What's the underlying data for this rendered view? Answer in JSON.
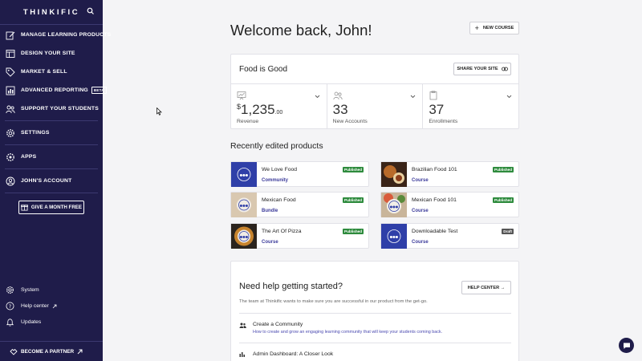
{
  "brand": {
    "logo": "THINKIFIC"
  },
  "sidebar": {
    "items": [
      {
        "label": "MANAGE LEARNING PRODUCTS",
        "icon": "edit-icon"
      },
      {
        "label": "DESIGN YOUR SITE",
        "icon": "layout-icon"
      },
      {
        "label": "MARKET & SELL",
        "icon": "tag-icon"
      },
      {
        "label": "ADVANCED REPORTING",
        "icon": "chart-icon",
        "badge": "BETA"
      },
      {
        "label": "SUPPORT YOUR STUDENTS",
        "icon": "users-icon"
      },
      {
        "label": "SETTINGS",
        "icon": "gear-icon"
      },
      {
        "label": "APPS",
        "icon": "apps-icon"
      },
      {
        "label": "JOHN'S ACCOUNT",
        "icon": "user-icon"
      }
    ],
    "give_button": "GIVE A MONTH FREE",
    "bottom": [
      {
        "label": "System",
        "icon": "gear-icon"
      },
      {
        "label": "Help center",
        "icon": "question-icon"
      },
      {
        "label": "Updates",
        "icon": "bell-icon"
      }
    ],
    "partner": "BECOME A PARTNER"
  },
  "main": {
    "welcome": "Welcome back, John!",
    "new_course": "NEW COURSE",
    "site": {
      "name": "Food is Good",
      "share": "SHARE YOUR SITE",
      "stats": [
        {
          "currency": "$",
          "value": "1,235",
          "cents": ".00",
          "label": "Revenue"
        },
        {
          "value": "33",
          "label": "New Accounts"
        },
        {
          "value": "37",
          "label": "Enrollments"
        }
      ]
    },
    "recent_title": "Recently edited products",
    "products": [
      {
        "name": "We Love Food",
        "type": "Community",
        "status": "Published"
      },
      {
        "name": "Brazilian Food 101",
        "type": "Course",
        "status": "Published"
      },
      {
        "name": "Mexican Food",
        "type": "Bundle",
        "status": "Published"
      },
      {
        "name": "Mexican Food 101",
        "type": "Course",
        "status": "Published"
      },
      {
        "name": "The Art Of Pizza",
        "type": "Course",
        "status": "Published"
      },
      {
        "name": "Downloadable Test",
        "type": "Course",
        "status": "Draft"
      }
    ],
    "help": {
      "title": "Need help getting started?",
      "button": "HELP CENTER →",
      "desc": "The team at Thinkific wants to make sure you are successful in our product from the get-go.",
      "items": [
        {
          "title": "Create a Community",
          "desc": "How to create and grow an engaging learning community that will keep your students coming back."
        },
        {
          "title": "Admin Dashboard: A Closer Look",
          "desc": ""
        }
      ]
    }
  },
  "colors": {
    "sidebar": "#1f1c4a",
    "published": "#2e8b3d",
    "draft": "#555555",
    "link": "#3b3a9a"
  }
}
